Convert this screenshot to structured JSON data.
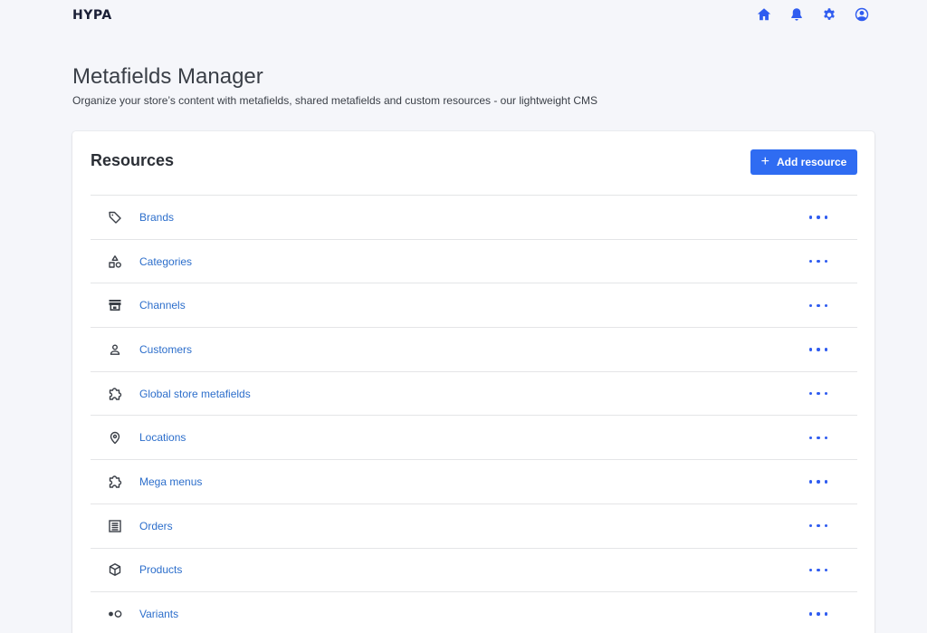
{
  "app": {
    "logo": "HYPA"
  },
  "topbar": {
    "icons": [
      "home-icon",
      "bell-icon",
      "gear-icon",
      "user-circle-icon"
    ],
    "accent_color": "#2f5cf0"
  },
  "header": {
    "title": "Metafields Manager",
    "subtitle": "Organize your store’s content with metafields, shared metafields and custom resources - our lightweight CMS"
  },
  "resources": {
    "title": "Resources",
    "add_button_label": "Add resource",
    "add_button_icon": "plus-icon",
    "items": [
      {
        "label": "Brands",
        "icon": "tag-icon"
      },
      {
        "label": "Categories",
        "icon": "shapes-icon"
      },
      {
        "label": "Channels",
        "icon": "store-icon"
      },
      {
        "label": "Customers",
        "icon": "person-icon"
      },
      {
        "label": "Global store metafields",
        "icon": "puzzle-icon"
      },
      {
        "label": "Locations",
        "icon": "location-pin-icon"
      },
      {
        "label": "Mega menus",
        "icon": "puzzle-icon"
      },
      {
        "label": "Orders",
        "icon": "document-list-icon"
      },
      {
        "label": "Products",
        "icon": "box-icon"
      },
      {
        "label": "Variants",
        "icon": "variants-toggle-icon"
      }
    ],
    "row_menu_icon": "more-horizontal-icon",
    "link_color": "#2c6ecb",
    "button_color": "#2f6cf2"
  }
}
